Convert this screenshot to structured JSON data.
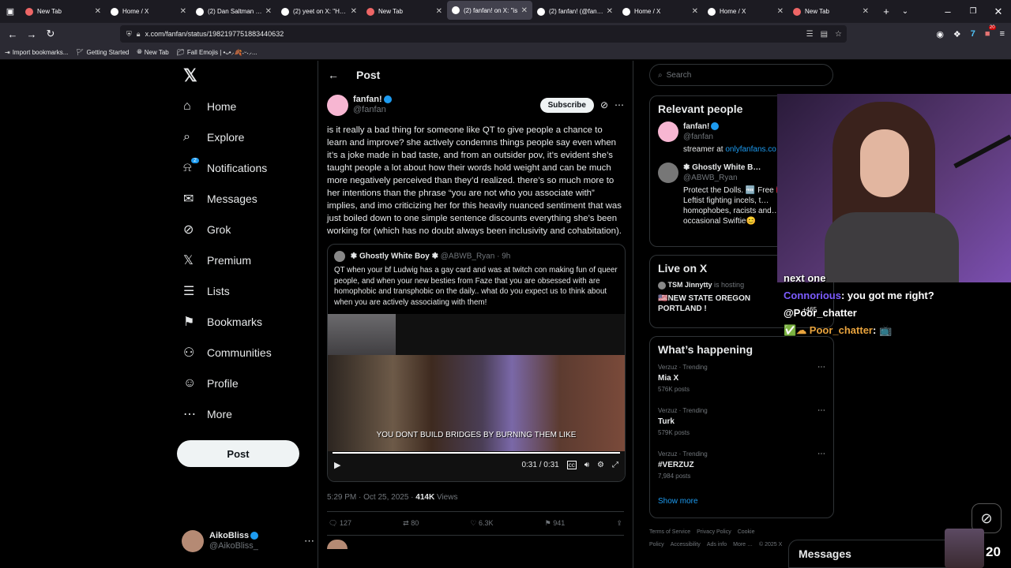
{
  "tabs": [
    {
      "title": "New Tab",
      "color": "#e66"
    },
    {
      "title": "Home / X",
      "color": "#fff"
    },
    {
      "title": "(2) Dan Saltman on",
      "color": "#fff"
    },
    {
      "title": "(2) yeet on X: \"Hasa",
      "color": "#fff"
    },
    {
      "title": "New Tab",
      "color": "#e66"
    },
    {
      "title": "(2) fanfan! on X: \"is",
      "color": "#fff",
      "active": true
    },
    {
      "title": "(2) fanfan! (@fanfan",
      "color": "#fff"
    },
    {
      "title": "Home / X",
      "color": "#fff"
    },
    {
      "title": "Home / X",
      "color": "#fff"
    },
    {
      "title": "New Tab",
      "color": "#e66"
    }
  ],
  "url": "x.com/fanfan/status/1982197751883440632",
  "bookmarks": [
    "Import bookmarks...",
    "Getting Started",
    "New Tab",
    "Fall Emojis | •ᴗ•⸝🍂˖ᵕ˖⸝..."
  ],
  "ext_badge": "20",
  "nav": [
    {
      "label": "Home",
      "icon": "⌂",
      "name": "home"
    },
    {
      "label": "Explore",
      "icon": "⌕",
      "name": "explore"
    },
    {
      "label": "Notifications",
      "icon": "⍾",
      "name": "notifications",
      "badge": "2"
    },
    {
      "label": "Messages",
      "icon": "✉",
      "name": "messages"
    },
    {
      "label": "Grok",
      "icon": "⊘",
      "name": "grok"
    },
    {
      "label": "Premium",
      "icon": "𝕏",
      "name": "premium"
    },
    {
      "label": "Lists",
      "icon": "☰",
      "name": "lists"
    },
    {
      "label": "Bookmarks",
      "icon": "⚑",
      "name": "bookmarks"
    },
    {
      "label": "Communities",
      "icon": "⚇",
      "name": "communities"
    },
    {
      "label": "Profile",
      "icon": "☺",
      "name": "profile"
    },
    {
      "label": "More",
      "icon": "⋯",
      "name": "more"
    }
  ],
  "post_button": "Post",
  "account": {
    "name": "AikoBliss",
    "handle": "@AikoBliss_"
  },
  "header": {
    "title": "Post"
  },
  "post": {
    "author": "fanfan!",
    "handle": "@fanfan",
    "subscribe": "Subscribe",
    "text": "is it really a bad thing for someone like QT to give people a chance to learn and improve? she actively condemns things people say even when it’s a joke made in bad taste, and from an outsider pov, it’s evident she’s taught people a lot about how their words hold weight and can be much more negatively perceived than they’d realized. there’s so much more to her intentions than the phrase “you are not who you associate with” implies, and imo criticizing her for this heavily nuanced sentiment that was just boiled down to one simple sentence discounts everything she’s been working for (which has no doubt always been inclusivity and cohabitation).",
    "quote": {
      "author": "❃ Ghostly White Boy ❃",
      "handle": "@ABWB_Ryan",
      "time": "9h",
      "text": "QT when your bf Ludwig has a gay card and was at twitch con making fun of queer people, and when your new besties from Faze that you are obsessed with are homophobic and transphobic on the daily.. what do you expect us to think about when you are actively associating with them!",
      "caption": "YOU DONT BUILD BRIDGES BY BURNING THEM LIKE",
      "time_display": "0:31 / 0:31",
      "progress": 1.0
    },
    "timestamp": "5:29 PM · Oct 25, 2025 · ",
    "views_count": "414K",
    "views_label": " Views",
    "stats": {
      "replies": "127",
      "reposts": "80",
      "likes": "6.3K",
      "bookmarks": "941"
    }
  },
  "search": {
    "placeholder": "Search"
  },
  "relevant": {
    "title": "Relevant people",
    "people": [
      {
        "name": "fanfan!",
        "handle": "@fanfan",
        "bio": "streamer at ",
        "link": "onlyfanfans.co"
      },
      {
        "name": "❃ Ghostly White B…",
        "handle": "@ABWB_Ryan",
        "bio": "Protect the Dolls. 🆓 Free 🇵🇸 Leftist fighting incels, t… homophobes, racists and… occasional Swiftie😊"
      }
    ]
  },
  "live": {
    "title": "Live on X",
    "host": "TSM Jinnytty",
    "hosting": "is hosting",
    "event": "🇺🇸NEW STATE OREGON PORTLAND !"
  },
  "happening": {
    "title": "What’s happening",
    "trends": [
      {
        "meta": "Verzuz · Trending",
        "name": "Mia X",
        "count": "576K posts"
      },
      {
        "meta": "Verzuz · Trending",
        "name": "Turk",
        "count": "579K posts"
      },
      {
        "meta": "Verzuz · Trending",
        "name": "#VERZUZ",
        "count": "7,984 posts"
      }
    ],
    "show_more": "Show more"
  },
  "footer": {
    "links": [
      "Terms of Service",
      "Privacy Policy",
      "Cookie Policy",
      "Accessibility",
      "Ads info",
      "More …",
      "© 2025 X"
    ]
  },
  "messages_label": "Messages",
  "overlay": {
    "chat": [
      {
        "user": "",
        "text": "next one",
        "color": "#fff"
      },
      {
        "user": "Connorious",
        "text": ": you got me right?",
        "color": "#7c5cff"
      },
      {
        "user": "",
        "text": "@Poor_chatter",
        "color": "#fff"
      },
      {
        "user": "✅☁ Poor_chatter",
        "text": ": 📺",
        "color": "#e8a33d"
      }
    ],
    "viewer_badge": "+465",
    "count": "20"
  }
}
